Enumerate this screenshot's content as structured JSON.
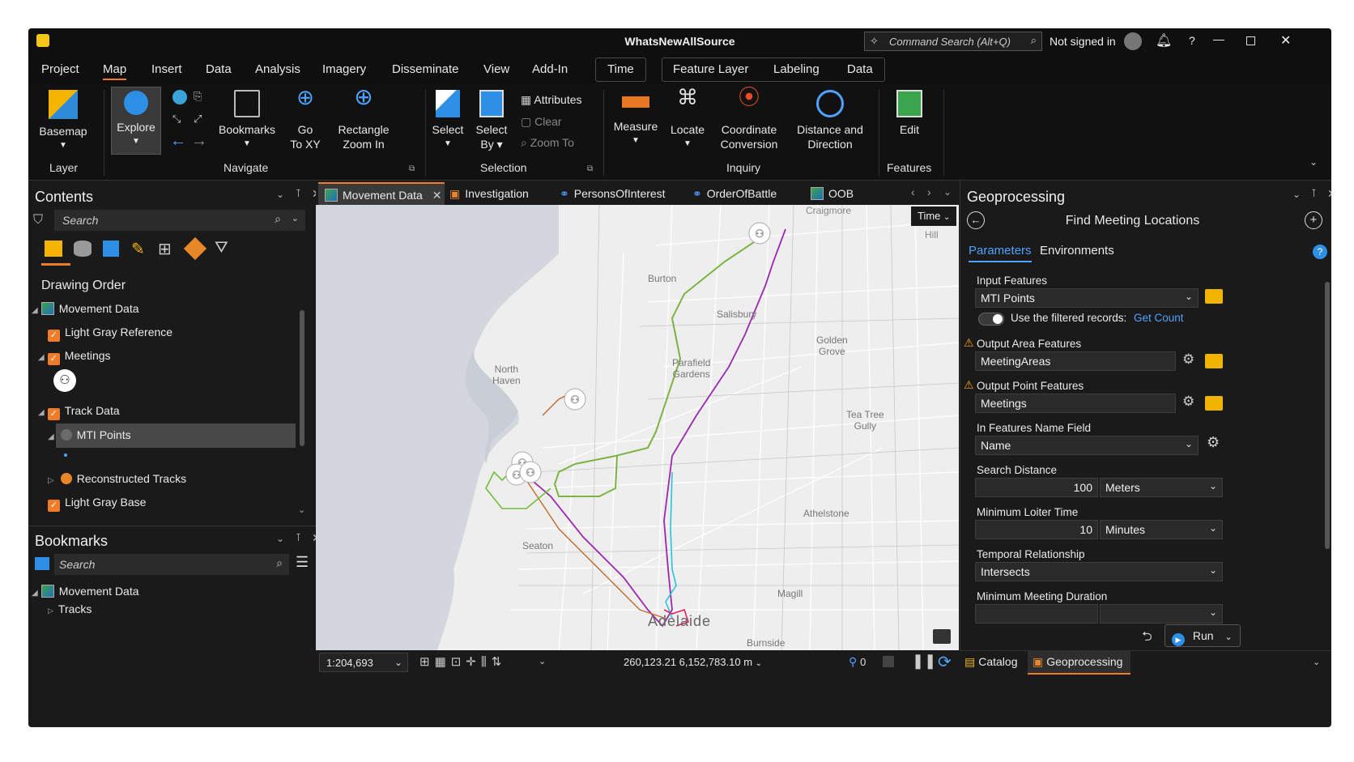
{
  "app_title": "WhatsNewAllSource",
  "command_search_placeholder": "Command Search (Alt+Q)",
  "signin_text": "Not signed in",
  "menu": [
    "Project",
    "Map",
    "Insert",
    "Data",
    "Analysis",
    "Imagery",
    "Disseminate",
    "View",
    "Add-In",
    "Time",
    "Feature Layer",
    "Labeling",
    "Data"
  ],
  "active_menu": "Map",
  "ribbon": {
    "basemap": "Basemap",
    "explore": "Explore",
    "bookmarks": "Bookmarks",
    "goto_xy_1": "Go",
    "goto_xy_2": "To XY",
    "rect_zoom_1": "Rectangle",
    "rect_zoom_2": "Zoom In",
    "select": "Select",
    "select_by_1": "Select",
    "select_by_2": "By",
    "attributes": "Attributes",
    "clear": "Clear",
    "zoom_to": "Zoom To",
    "measure": "Measure",
    "locate": "Locate",
    "coord_1": "Coordinate",
    "coord_2": "Conversion",
    "dist_1": "Distance and",
    "dist_2": "Direction",
    "edit": "Edit",
    "groups": {
      "layer": "Layer",
      "navigate": "Navigate",
      "selection": "Selection",
      "inquiry": "Inquiry",
      "features": "Features"
    }
  },
  "contents": {
    "title": "Contents",
    "search_placeholder": "Search",
    "drawing_order": "Drawing Order",
    "items": {
      "movement_data": "Movement Data",
      "light_gray_ref": "Light Gray Reference",
      "meetings": "Meetings",
      "track_data": "Track Data",
      "mti_points": "MTI Points",
      "reconstructed_tracks": "Reconstructed Tracks",
      "light_gray_base": "Light Gray Base"
    }
  },
  "bookmarks": {
    "title": "Bookmarks",
    "search_placeholder": "Search",
    "movement_data": "Movement Data",
    "tracks": "Tracks"
  },
  "map_tabs": [
    "Movement Data",
    "Investigation",
    "PersonsOfInterest",
    "OrderOfBattle",
    "OOB"
  ],
  "map": {
    "time_button": "Time",
    "places": {
      "craigmore": "Craigmore",
      "hill": "Hill",
      "burton": "Burton",
      "salisbury": "Salisbury",
      "golden_grove_1": "Golden",
      "golden_grove_2": "Grove",
      "north_haven_1": "North",
      "north_haven_2": "Haven",
      "parafield_1": "Parafield",
      "parafield_2": "Gardens",
      "tea_tree_1": "Tea Tree",
      "tea_tree_2": "Gully",
      "athelstone": "Athelstone",
      "seaton": "Seaton",
      "magill": "Magill",
      "adelaide": "Adelaide",
      "burnside": "Burnside"
    }
  },
  "status": {
    "scale": "1:204,693",
    "coords": "260,123.21 6,152,783.10 m",
    "selected_count": "0"
  },
  "geoprocessing": {
    "title": "Geoprocessing",
    "tool_name": "Find Meeting Locations",
    "tab_parameters": "Parameters",
    "tab_environments": "Environments",
    "input_features_label": "Input Features",
    "input_features_value": "MTI Points",
    "use_filtered": "Use the filtered records:",
    "get_count": "Get Count",
    "output_area_label": "Output Area Features",
    "output_area_value": "MeetingAreas",
    "output_point_label": "Output Point Features",
    "output_point_value": "Meetings",
    "name_field_label": "In Features Name Field",
    "name_field_value": "Name",
    "search_distance_label": "Search Distance",
    "search_distance_value": "100",
    "search_distance_unit": "Meters",
    "min_loiter_label": "Minimum Loiter Time",
    "min_loiter_value": "10",
    "min_loiter_unit": "Minutes",
    "temporal_label": "Temporal Relationship",
    "temporal_value": "Intersects",
    "min_meeting_label": "Minimum Meeting Duration",
    "run": "Run"
  },
  "bottom_tabs": {
    "catalog": "Catalog",
    "geoprocessing": "Geoprocessing"
  },
  "colors": {
    "accent": "#f07c2a",
    "link": "#4fa3ff",
    "bg": "#1a1a1a"
  }
}
